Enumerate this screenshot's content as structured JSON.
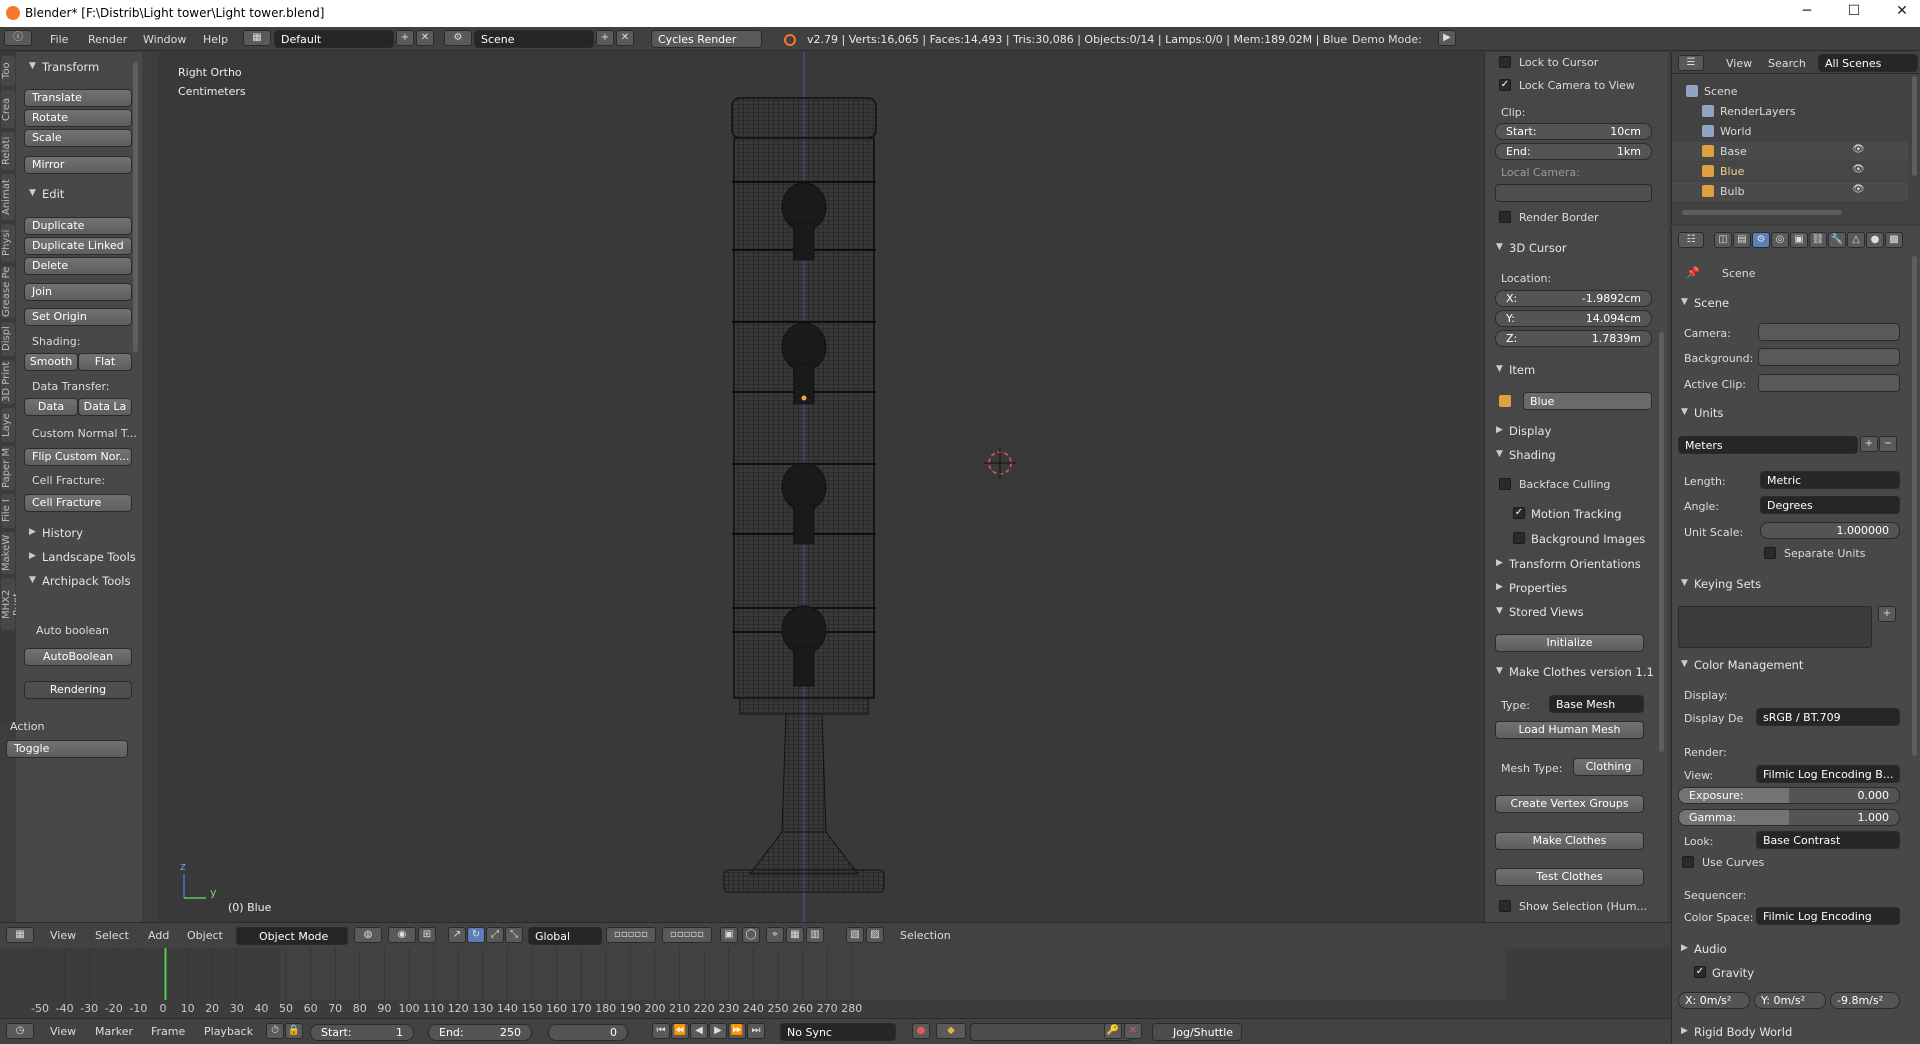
{
  "window": {
    "title": "Blender* [F:\\Distrib\\Light tower\\Light tower.blend]",
    "minimize": "─",
    "maximize": "☐",
    "close": "✕"
  },
  "infobar": {
    "menus": [
      "File",
      "Render",
      "Window",
      "Help"
    ],
    "layout": "Default",
    "scene": "Scene",
    "engine": "Cycles Render",
    "stats": "v2.79 | Verts:16,065 | Faces:14,493 | Tris:30,086 | Objects:0/14 | Lamps:0/0 | Mem:189.02M | Blue",
    "demo_mode": "Demo Mode:"
  },
  "left_tabs": [
    "Too",
    "Crea",
    "Relati",
    "Animat",
    "Physi",
    "Grease Pe",
    "Displ",
    "3D Print",
    "Laye",
    "Paper M",
    "File I",
    "MakeW",
    "MHX2 Runt"
  ],
  "left": {
    "transform_header": "Transform",
    "translate": "Translate",
    "rotate": "Rotate",
    "scale": "Scale",
    "mirror": "Mirror",
    "edit_header": "Edit",
    "duplicate": "Duplicate",
    "duplicate_linked": "Duplicate Linked",
    "delete": "Delete",
    "join": "Join",
    "set_origin": "Set Origin",
    "shading_label": "Shading:",
    "smooth": "Smooth",
    "flat": "Flat",
    "data_transfer_label": "Data Transfer:",
    "data": "Data",
    "data_la": "Data La",
    "custom_normal": "Custom Normal T...",
    "flip_custom": "Flip Custom Nor...",
    "cell_fracture_label": "Cell Fracture:",
    "cell_fracture": "Cell Fracture",
    "history": "History",
    "landscape_tools": "Landscape Tools",
    "archipack_tools": "Archipack Tools",
    "auto_boolean": "Auto boolean",
    "autoboolean": "AutoBoolean",
    "rendering": "Rendering",
    "action_label": "Action",
    "action_value": "Toggle"
  },
  "viewport": {
    "view_name": "Right Ortho",
    "units": "Centimeters",
    "object_label": "(0) Blue",
    "axis_y": "y",
    "axis_z": "z"
  },
  "npanel": {
    "lock_to_cursor": "Lock to Cursor",
    "lock_camera": "Lock Camera to View",
    "clip_label": "Clip:",
    "clip_start": {
      "k": "Start:",
      "v": "10cm"
    },
    "clip_end": {
      "k": "End:",
      "v": "1km"
    },
    "local_camera": "Local Camera:",
    "render_border": "Render Border",
    "cursor_header": "3D Cursor",
    "location": "Location:",
    "cx": {
      "k": "X:",
      "v": "-1.9892cm"
    },
    "cy": {
      "k": "Y:",
      "v": "14.094cm"
    },
    "cz": {
      "k": "Z:",
      "v": "1.7839m"
    },
    "item_header": "Item",
    "item_name": "Blue",
    "display": "Display",
    "shading": "Shading",
    "backface": "Backface Culling",
    "motion_tracking": "Motion Tracking",
    "background_images": "Background Images",
    "transform_orient": "Transform Orientations",
    "properties": "Properties",
    "stored_views": "Stored Views",
    "initialize": "Initialize",
    "make_clothes": "Make Clothes version 1.1",
    "type_label": "Type:",
    "type_value": "Base Mesh",
    "load_human": "Load Human Mesh",
    "mesh_type_label": "Mesh Type:",
    "mesh_type_value": "Clothing",
    "create_vg": "Create Vertex Groups",
    "make_clothes_btn": "Make Clothes",
    "test_clothes": "Test Clothes",
    "show_selection": "Show Selection (Hum..."
  },
  "outliner": {
    "view": "View",
    "search": "Search",
    "all_scenes": "All Scenes",
    "items": [
      {
        "label": "Scene"
      },
      {
        "label": "RenderLayers"
      },
      {
        "label": "World"
      },
      {
        "label": "Base"
      },
      {
        "label": "Blue"
      },
      {
        "label": "Bulb"
      }
    ]
  },
  "props": {
    "scene_path": "Scene",
    "scene_header": "Scene",
    "camera": "Camera:",
    "background": "Background:",
    "active_clip": "Active Clip:",
    "units_header": "Units",
    "units_preset": "Meters",
    "length": "Length:",
    "length_value": "Metric",
    "angle": "Angle:",
    "angle_value": "Degrees",
    "unit_scale": "Unit Scale:",
    "unit_scale_value": "1.000000",
    "separate_units": "Separate Units",
    "keying_sets": "Keying Sets",
    "color_mgmt": "Color Management",
    "display_label": "Display:",
    "display_de": "Display De",
    "display_value": "sRGB / BT.709",
    "render_label": "Render:",
    "view": "View:",
    "view_value": "Filmic Log Encoding B...",
    "exposure": "Exposure:",
    "exposure_value": "0.000",
    "exposure_level": 0.5,
    "gamma": "Gamma:",
    "gamma_value": "1.000",
    "gamma_level": 0.5,
    "look": "Look:",
    "look_value": "Base Contrast",
    "use_curves": "Use Curves",
    "sequencer": "Sequencer:",
    "color_space": "Color Space:",
    "color_space_value": "Filmic Log Encoding",
    "audio": "Audio",
    "gravity": "Gravity",
    "gx": "X: 0m/s²",
    "gy": "Y: 0m/s²",
    "gz": "-9.8m/s²",
    "rigid_body": "Rigid Body World"
  },
  "vp_header": {
    "view": "View",
    "select": "Select",
    "add": "Add",
    "object": "Object",
    "mode": "Object Mode",
    "orientation": "Global",
    "selection": "Selection"
  },
  "timeline": {
    "ticks": [
      "-50",
      "-40",
      "-30",
      "-20",
      "-10",
      "0",
      "10",
      "20",
      "30",
      "40",
      "50",
      "60",
      "70",
      "80",
      "90",
      "100",
      "110",
      "120",
      "130",
      "140",
      "150",
      "160",
      "170",
      "180",
      "190",
      "200",
      "210",
      "220",
      "230",
      "240",
      "250",
      "260",
      "270",
      "280"
    ],
    "current_frame": 1
  },
  "tl_header": {
    "view": "View",
    "marker": "Marker",
    "frame": "Frame",
    "playback": "Playback",
    "start": {
      "k": "Start:",
      "v": "1"
    },
    "end": {
      "k": "End:",
      "v": "250"
    },
    "current": "0",
    "sync": "No Sync",
    "keying": "Jog/Shuttle"
  },
  "colors": {
    "accent_blue": "#5b7fb8",
    "selected_text": "#f2a23c",
    "cursor_red": "#e05a5a",
    "frame_line": "#4fd14f"
  }
}
